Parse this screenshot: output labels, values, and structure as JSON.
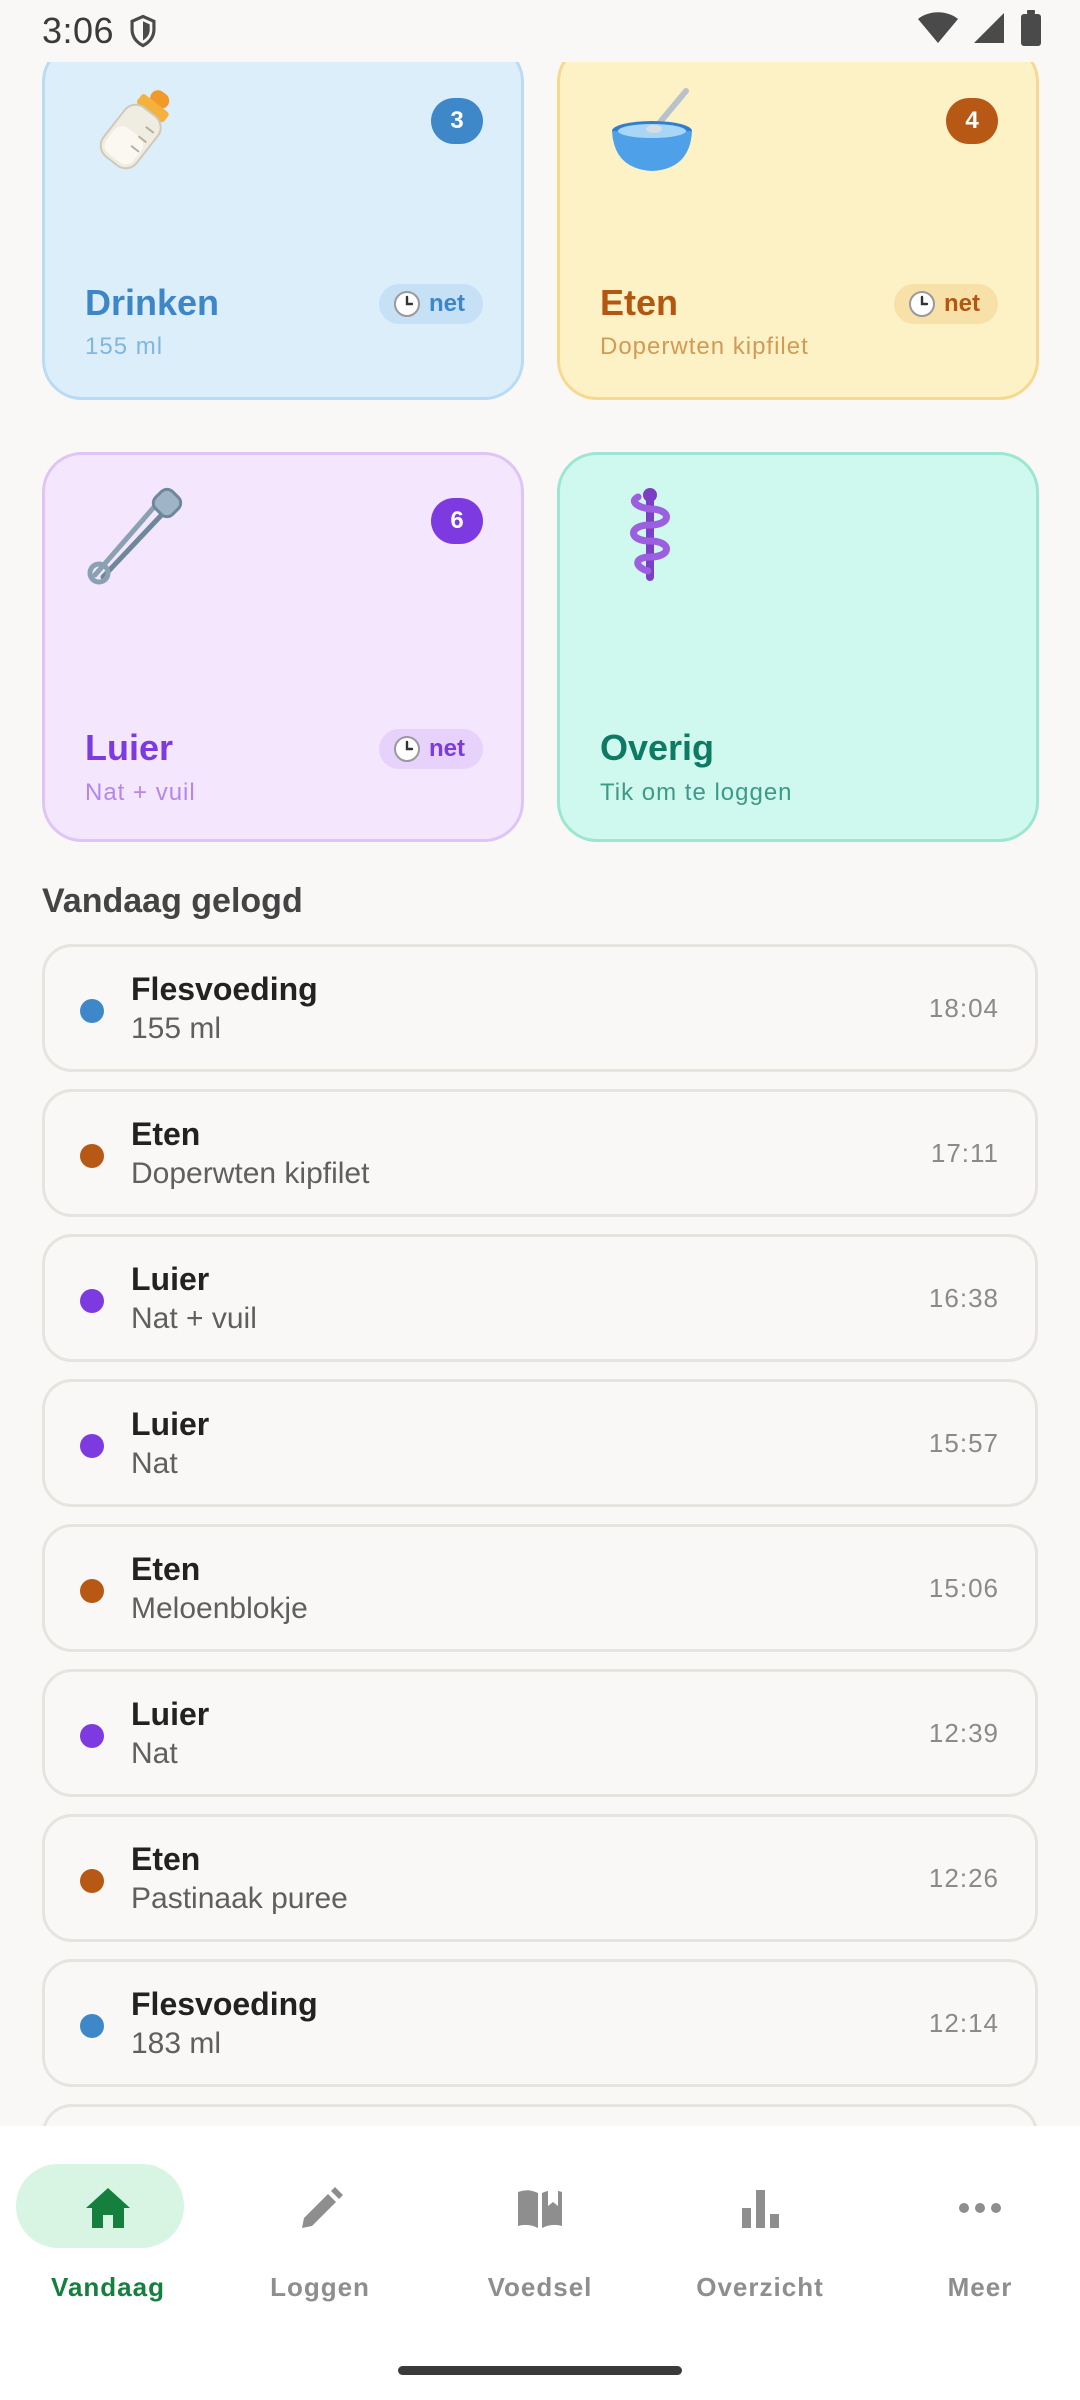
{
  "status_bar": {
    "time": "3:06"
  },
  "tiles": [
    {
      "key": "drinken",
      "title": "Drinken",
      "subtitle": "155 ml",
      "count": "3",
      "chip": "net",
      "icon": "baby-bottle-icon"
    },
    {
      "key": "eten",
      "title": "Eten",
      "subtitle": "Doperwten kipfilet",
      "count": "4",
      "chip": "net",
      "icon": "bowl-spoon-icon"
    },
    {
      "key": "luier",
      "title": "Luier",
      "subtitle": "Nat + vuil",
      "count": "6",
      "chip": "net",
      "icon": "safety-pin-icon"
    },
    {
      "key": "overig",
      "title": "Overig",
      "subtitle": "Tik om te loggen",
      "icon": "medical-staff-icon"
    }
  ],
  "section_title": "Vandaag gelogd",
  "log": [
    {
      "name": "Flesvoeding",
      "detail": "155 ml",
      "time": "18:04",
      "color": "#3e88c9"
    },
    {
      "name": "Eten",
      "detail": "Doperwten kipfilet",
      "time": "17:11",
      "color": "#b75915"
    },
    {
      "name": "Luier",
      "detail": "Nat + vuil",
      "time": "16:38",
      "color": "#7c3ae0"
    },
    {
      "name": "Luier",
      "detail": "Nat",
      "time": "15:57",
      "color": "#7c3ae0"
    },
    {
      "name": "Eten",
      "detail": "Meloenblokje",
      "time": "15:06",
      "color": "#b75915"
    },
    {
      "name": "Luier",
      "detail": "Nat",
      "time": "12:39",
      "color": "#7c3ae0"
    },
    {
      "name": "Eten",
      "detail": "Pastinaak puree",
      "time": "12:26",
      "color": "#b75915"
    },
    {
      "name": "Flesvoeding",
      "detail": "183 ml",
      "time": "12:14",
      "color": "#3e88c9"
    }
  ],
  "nav": [
    {
      "label": "Vandaag",
      "icon": "home-icon",
      "active": true
    },
    {
      "label": "Loggen",
      "icon": "pencil-icon"
    },
    {
      "label": "Voedsel",
      "icon": "book-icon"
    },
    {
      "label": "Overzicht",
      "icon": "bar-chart-icon"
    },
    {
      "label": "Meer",
      "icon": "more-dots-icon"
    }
  ],
  "colors": {
    "accent": "#15803d",
    "active_pill": "#d7f5e2"
  }
}
